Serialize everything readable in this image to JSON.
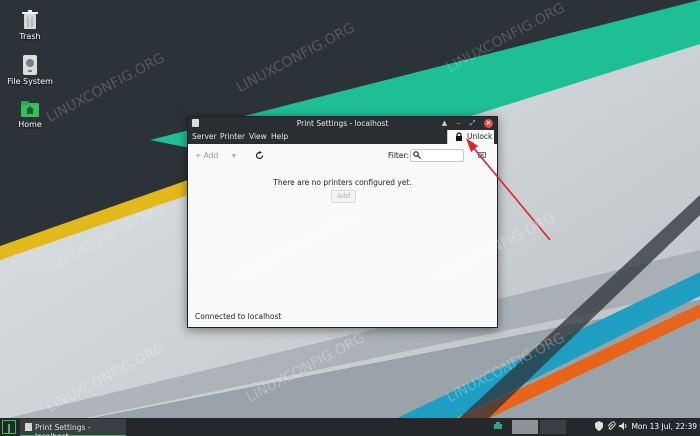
{
  "desktop": {
    "icons": [
      {
        "label": "Trash"
      },
      {
        "label": "File System"
      },
      {
        "label": "Home"
      }
    ],
    "watermark": "LINUXCONFIG.ORG"
  },
  "window": {
    "title": "Print Settings - localhost",
    "menu": [
      "Server",
      "Printer",
      "View",
      "Help"
    ],
    "unlock_label": "Unlock",
    "toolbar": {
      "add_label": "Add",
      "filter_label": "Filter:"
    },
    "filter_value": "",
    "empty_message": "There are no printers configured yet.",
    "add_button_label": "Add",
    "status": "Connected to localhost"
  },
  "taskbar": {
    "task_label": "Print Settings - localhost",
    "clock": "Mon 13 Jul, 22:39"
  },
  "colors": {
    "accent_green": "#35bf5c",
    "teal": "#1fbf95",
    "yellow": "#e1b91a",
    "orange": "#e8641a",
    "blue": "#1e9fc1",
    "arrow": "#d9252b"
  }
}
